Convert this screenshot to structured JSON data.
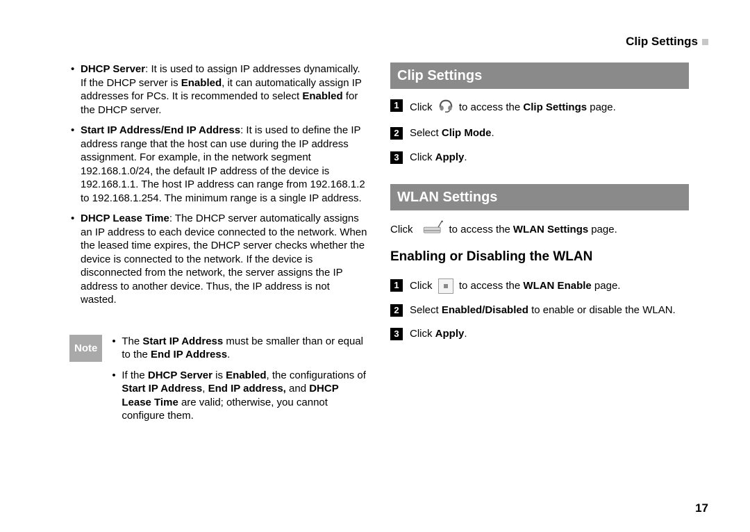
{
  "header": {
    "running_title": "Clip Settings"
  },
  "left": {
    "bullets": [
      {
        "term": "DHCP Server",
        "rest_a": ": It is used to assign IP addresses dynamically. If the DHCP server is ",
        "bold_mid": "Enabled",
        "rest_b": ", it can automatically assign IP addresses for PCs. It is recommended to select ",
        "bold_end": "Enabled",
        "rest_c": " for the DHCP server."
      },
      {
        "term": "Start IP Address/End IP Address",
        "rest_a": ": It is used to define the IP address range that the host can use during the IP address assignment. For example, in the network segment 192.168.1.0/24, the default IP address of the device is 192.168.1.1. The host IP address can range from 192.168.1.2 to 192.168.1.254. The minimum range is a single IP address."
      },
      {
        "term": "DHCP Lease Time",
        "rest_a": ": The DHCP server automatically assigns an IP address to each device connected to the network. When the leased time expires, the DHCP server checks whether the device is connected to the network. If the device is disconnected from the network, the server assigns the IP address to another device. Thus, the IP address is not wasted."
      }
    ],
    "note_label": "Note",
    "note_items": [
      {
        "pre": "The ",
        "b1": "Start IP Address",
        "mid": " must be smaller than or equal to the ",
        "b2": "End IP Address",
        "post": "."
      },
      {
        "pre": "If the ",
        "b1": "DHCP Server",
        "mid": " is ",
        "b2": "Enabled",
        "mid2": ", the configurations of ",
        "b3": "Start IP Address",
        "sep1": ", ",
        "b4": "End IP address,",
        "sep2": " and ",
        "b5": "DHCP Lease Time",
        "post": " are valid; otherwise, you cannot configure them."
      }
    ]
  },
  "right": {
    "clip_heading": "Clip Settings",
    "clip_steps": [
      {
        "n": "1",
        "pre": "Click ",
        "icon": "headphones",
        "post_a": " to access the ",
        "bold": "Clip Settings",
        "post_b": " page."
      },
      {
        "n": "2",
        "pre": "Select ",
        "bold": "Clip Mode",
        "post_b": "."
      },
      {
        "n": "3",
        "pre": "Click ",
        "bold": "Apply",
        "post_b": "."
      }
    ],
    "wlan_heading": "WLAN Settings",
    "wlan_intro_pre": "Click ",
    "wlan_intro_post_a": " to access the ",
    "wlan_intro_bold": "WLAN Settings",
    "wlan_intro_post_b": " page.",
    "wlan_sub": "Enabling or Disabling the WLAN",
    "wlan_steps": [
      {
        "n": "1",
        "pre": "Click ",
        "icon": "square",
        "post_a": " to access the ",
        "bold": "WLAN Enable",
        "post_b": " page."
      },
      {
        "n": "2",
        "pre": "Select ",
        "bold": "Enabled/Disabled",
        "post_b": " to enable or disable the WLAN."
      },
      {
        "n": "3",
        "pre": "Click ",
        "bold": "Apply",
        "post_b": "."
      }
    ]
  },
  "page_number": "17"
}
